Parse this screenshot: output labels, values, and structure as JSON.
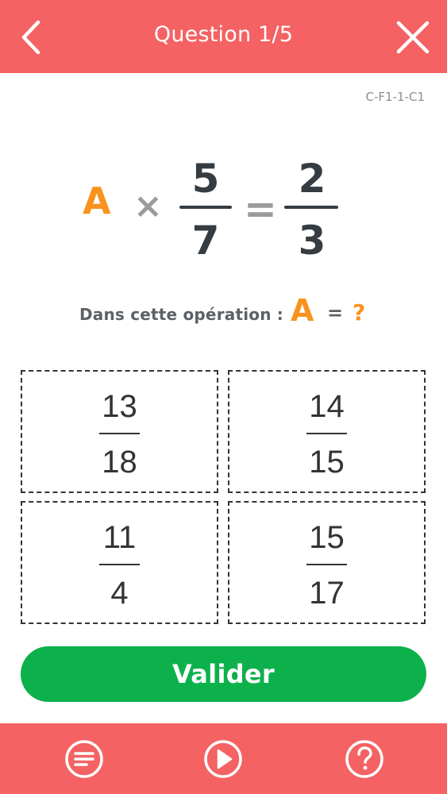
{
  "header": {
    "title": "Question 1/5",
    "back_icon": "chevron-left-icon",
    "close_icon": "close-icon",
    "color": "#f46263"
  },
  "question_code": "C-F1-1-C1",
  "equation": {
    "variable": "A",
    "times_sign": "×",
    "left_fraction": {
      "numerator": "5",
      "denominator": "7"
    },
    "equals_sign": "=",
    "right_fraction": {
      "numerator": "2",
      "denominator": "3"
    }
  },
  "prompt": {
    "text": "Dans cette opération :",
    "variable": "A",
    "equals": "=",
    "question_mark": "?"
  },
  "choices": [
    {
      "numerator": "13",
      "denominator": "18"
    },
    {
      "numerator": "14",
      "denominator": "15"
    },
    {
      "numerator": "11",
      "denominator": "4"
    },
    {
      "numerator": "15",
      "denominator": "17"
    }
  ],
  "validate_label": "Valider",
  "bottom_bar": {
    "items": [
      {
        "icon": "list-icon"
      },
      {
        "icon": "play-icon"
      },
      {
        "icon": "help-icon"
      }
    ]
  },
  "colors": {
    "accent_orange": "#f7931e",
    "validate_green": "#0db14b",
    "header_red": "#f46263"
  }
}
